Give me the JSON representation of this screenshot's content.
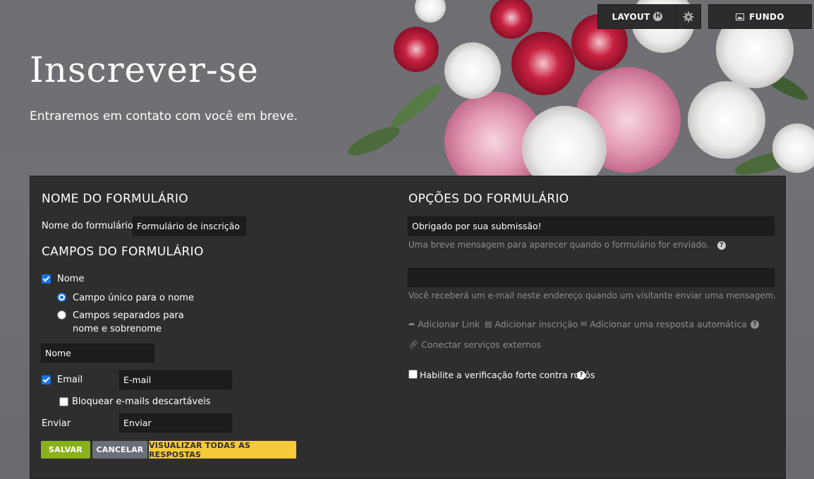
{
  "header": {
    "title": "Inscrever-se",
    "subtitle": "Entraremos em contato com você em breve.",
    "layout_label": "LAYOUT",
    "layout_badge": "H",
    "fundo_label": "FUNDO"
  },
  "form_name": {
    "section_title": "NOME DO FORMULÁRIO",
    "label": "Nome do formulário",
    "value": "Formulário de inscrição"
  },
  "form_fields": {
    "section_title": "CAMPOS DO FORMULÁRIO",
    "name_checkbox_label": "Nome",
    "name_checked": true,
    "radio_single_label": "Campo único para o nome",
    "radio_separate_label_line1": "Campos separados para",
    "radio_separate_label_line2": "nome e sobrenome",
    "name_input_value": "Nome",
    "email_checkbox_label": "Email",
    "email_checked": true,
    "email_input_value": "E-mail",
    "block_disposable_label": "Bloquear e-mails descartáveis",
    "block_disposable_checked": false,
    "submit_label": "Enviar",
    "submit_input_value": "Enviar"
  },
  "form_options": {
    "section_title": "OPÇÕES DO FORMULÁRIO",
    "thanks_value": "Obrigado por sua submissão!",
    "thanks_help": "Uma breve mensagem para aparecer quando o formulário for enviado.",
    "email_value": "",
    "email_help": "Você receberá um e-mail neste endereço quando um visitante enviar uma mensagem.",
    "add_link": "Adicionar Link",
    "add_subscription": "Adicionar inscrição",
    "add_autoresponse": "Adicionar uma resposta automática",
    "connect_services": "Conectar serviços externos",
    "robot_check_label": "Habilite a verificação forte contra robôs",
    "robot_check_checked": false
  },
  "actions": {
    "save": "SALVAR",
    "cancel": "CANCELAR",
    "view_all": "VISUALIZAR TODAS AS RESPOSTAS"
  },
  "colors": {
    "panel_bg": "#2e2e2f",
    "save_green": "#8ab11c",
    "cancel_gray": "#6a7078",
    "view_yellow": "#f4c93a",
    "checkbox_blue": "#1a73e8"
  },
  "icons": [
    "gear-icon",
    "image-icon",
    "question-icon",
    "share-icon",
    "list-icon",
    "mail-icon",
    "link-icon"
  ]
}
